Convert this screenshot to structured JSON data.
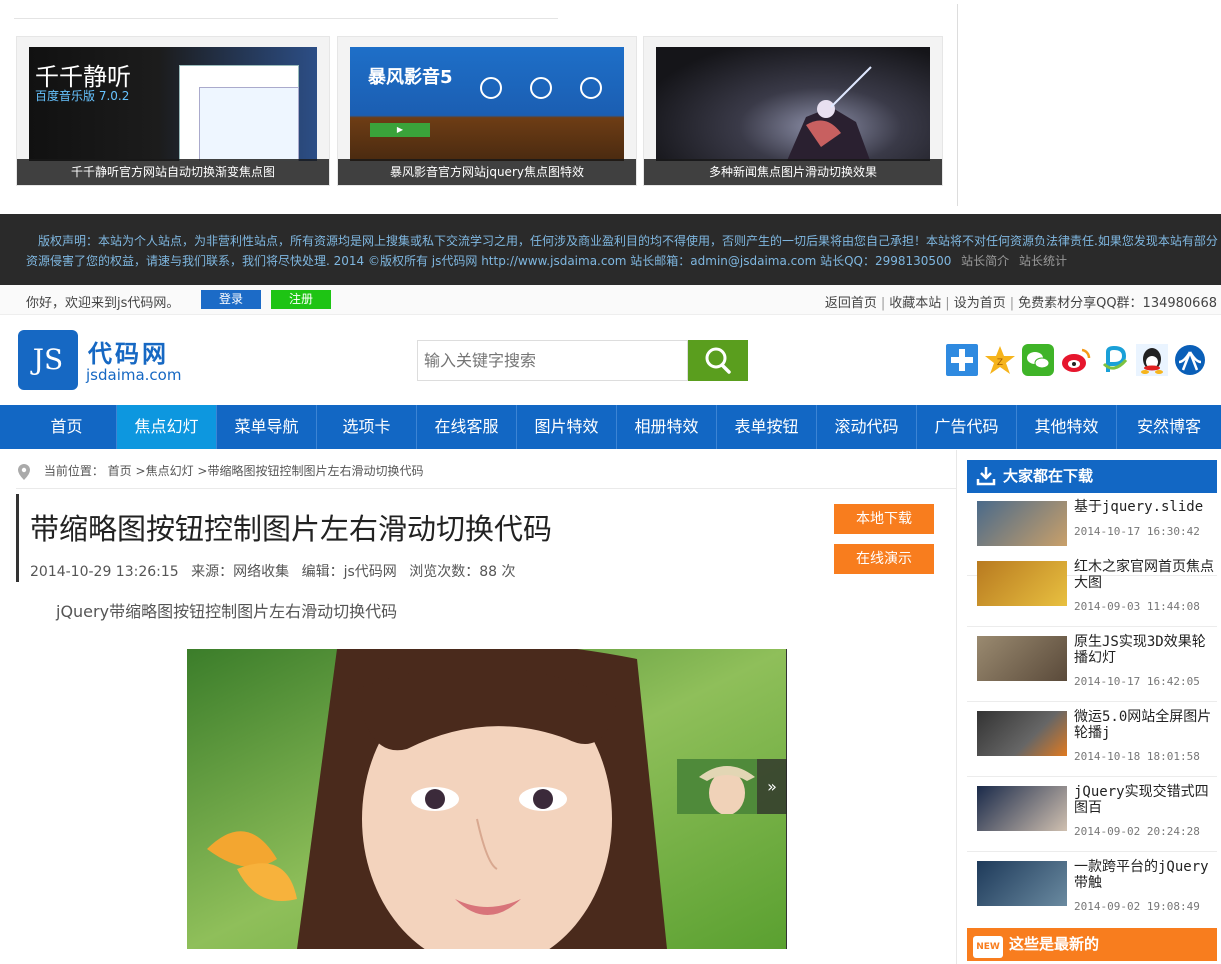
{
  "top_demos": [
    {
      "caption": "千千静听官方网站自动切换渐变焦点图",
      "logo_text": "千千静听",
      "version_text": "百度音乐版 7.0.2"
    },
    {
      "caption": "暴风影音官方网站jquery焦点图特效",
      "logo_text": "暴风影音5"
    },
    {
      "caption": "多种新闻焦点图片滑动切换效果"
    }
  ],
  "copyright": {
    "line1": "版权声明：本站为个人站点，为非营利性站点，所有资源均是网上搜集或私下交流学习之用，任何涉及商业盈利目的均不得使用，否则产生的一切后果将由您自己承担！本站将不对任何资源负法律责任.如果您发现本站有部分",
    "line2": "资源侵害了您的权益，请速与我们联系，我们将尽快处理. 2014 ©版权所有 js代码网 http://www.jsdaima.com 站长邮箱：admin@jsdaima.com 站长QQ：2998130500",
    "link_intro": "站长简介",
    "link_stats": "站长统计"
  },
  "welcome": {
    "message": "你好，欢迎来到js代码网。",
    "login": "登录",
    "register": "注册",
    "links": [
      "返回首页",
      "收藏本站",
      "设为首页",
      "免费素材分享QQ群：134980668"
    ]
  },
  "header": {
    "logo_mark": "JS",
    "logo_name": "代码网",
    "logo_url": "jsdaima.com",
    "search_placeholder": "输入关键字搜索"
  },
  "social_icons": [
    "add-icon",
    "qzone-icon",
    "wechat-icon",
    "weibo-icon",
    "pengyou-icon",
    "qq-icon",
    "renren-icon"
  ],
  "nav": {
    "items": [
      "首页",
      "焦点幻灯",
      "菜单导航",
      "选项卡",
      "在线客服",
      "图片特效",
      "相册特效",
      "表单按钮",
      "滚动代码",
      "广告代码",
      "其他特效",
      "安然博客"
    ],
    "active_index": 1
  },
  "breadcrumb": {
    "prefix": "当前位置：",
    "home": "首页",
    "category": ">焦点幻灯",
    "current": ">带缩略图按钮控制图片左右滑动切换代码"
  },
  "article": {
    "title": "带缩略图按钮控制图片左右滑动切换代码",
    "date": "2014-10-29 13:26:15",
    "source": "来源：网络收集",
    "editor": "编辑：js代码网",
    "views": "浏览次数：88 次",
    "download_button": "本地下载",
    "demo_button": "在线演示",
    "description": "jQuery带缩略图按钮控制图片左右滑动切换代码",
    "next_arrow": "»"
  },
  "sidebar": {
    "heading": "大家都在下载",
    "items": [
      {
        "title": "基于jquery.slide",
        "date": "2014-10-17 16:30:42"
      },
      {
        "title": "红木之家官网首页焦点大图",
        "date": "2014-09-03 11:44:08"
      },
      {
        "title": "原生JS实现3D效果轮播幻灯",
        "date": "2014-10-17 16:42:05"
      },
      {
        "title": "微运5.0网站全屏图片轮播j",
        "date": "2014-10-18 18:01:58"
      },
      {
        "title": "jQuery实现交错式四图百",
        "date": "2014-09-02 20:24:28"
      },
      {
        "title": "一款跨平台的jQuery带触",
        "date": "2014-09-02 19:08:49"
      }
    ],
    "new_badge": "NEW",
    "new_heading": "这些是最新的"
  },
  "colors": {
    "nav_blue": "#1267c4",
    "nav_active": "#0d97df",
    "orange": "#f87d1e",
    "search_green": "#5a9e1e"
  }
}
